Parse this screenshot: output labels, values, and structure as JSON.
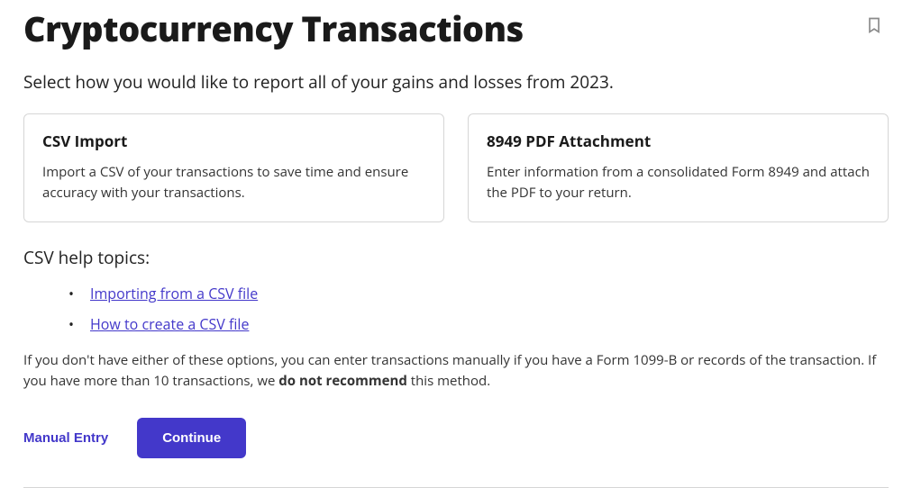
{
  "page": {
    "title": "Cryptocurrency Transactions",
    "subtitle": "Select how you would like to report all of your gains and losses from 2023."
  },
  "options": {
    "csv": {
      "title": "CSV Import",
      "description": "Import a CSV of your transactions to save time and ensure accuracy with your transactions."
    },
    "pdf": {
      "title": "8949 PDF Attachment",
      "description": "Enter information from a consolidated Form 8949 and attach the PDF to your return."
    }
  },
  "help": {
    "heading": "CSV help topics:",
    "links": {
      "importing": "Importing from a CSV file",
      "creating": "How to create a CSV file"
    }
  },
  "note": {
    "pre": "If you don't have either of these options, you can enter transactions manually if you have a Form 1099-B or records of the transaction. If you have more than 10 transactions, we ",
    "bold": "do not recommend",
    "post": " this method."
  },
  "buttons": {
    "manual": "Manual Entry",
    "continue": "Continue"
  }
}
